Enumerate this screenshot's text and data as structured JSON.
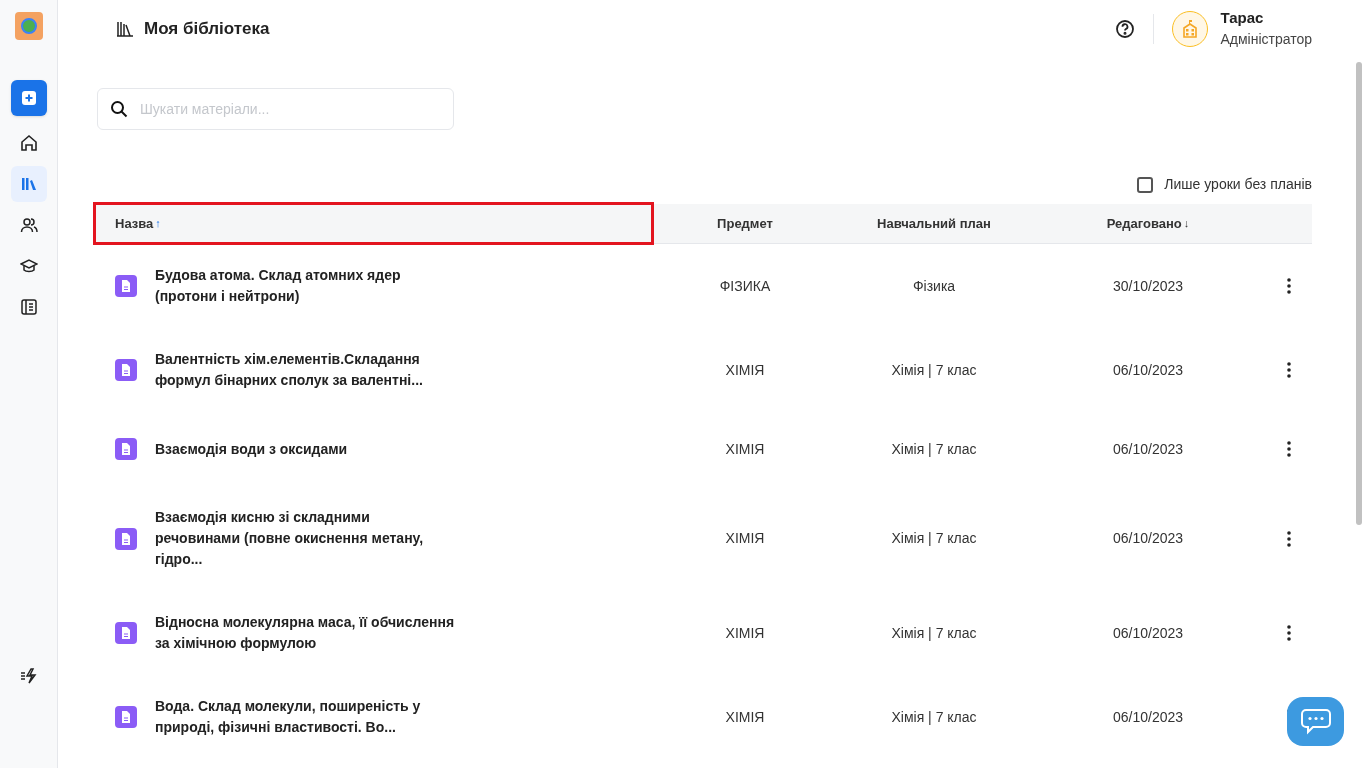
{
  "sidebar": {
    "items": [
      {
        "kind": "home",
        "selected": false
      },
      {
        "kind": "library",
        "selected": true
      },
      {
        "kind": "people",
        "selected": false
      },
      {
        "kind": "cap",
        "selected": false
      },
      {
        "kind": "book",
        "selected": false
      }
    ],
    "bottom_items": [
      {
        "kind": "flash",
        "selected": false
      }
    ]
  },
  "header": {
    "title": "Моя бібліотека",
    "user": {
      "name": "Тарас",
      "role": "Адміністратор"
    }
  },
  "search": {
    "placeholder": "Шукати матеріали..."
  },
  "filter": {
    "label": "Лише уроки без планів",
    "checked": false
  },
  "table": {
    "columns": [
      {
        "label": "Назва",
        "sort_arrow": "↑",
        "sort_active": true
      },
      {
        "label": "Предмет"
      },
      {
        "label": "Навчальний план"
      },
      {
        "label": "Редаговано",
        "sort_arrow": "↓",
        "sort_active": false
      }
    ],
    "rows": [
      {
        "title": "Будова атома. Склад атомних ядер (протони і нейтрони)",
        "subject": "ФІЗИКА",
        "plan": "Фізика",
        "edited": "30/10/2023"
      },
      {
        "title": "Валентність хім.елементів.Складання формул бінарних сполук за валентні...",
        "subject": "ХІМІЯ",
        "plan": "Хімія | 7 клас",
        "edited": "06/10/2023"
      },
      {
        "title": "Взаємодія води з оксидами",
        "subject": "ХІМІЯ",
        "plan": "Хімія | 7 клас",
        "edited": "06/10/2023"
      },
      {
        "title": "Взаємодія кисню зі складними речовинами (повне окиснення метану, гідро...",
        "subject": "ХІМІЯ",
        "plan": "Хімія | 7 клас",
        "edited": "06/10/2023"
      },
      {
        "title": "Відносна молекулярна маса, її обчислення за хімічною формулою",
        "subject": "ХІМІЯ",
        "plan": "Хімія | 7 клас",
        "edited": "06/10/2023"
      },
      {
        "title": "Вода. Склад молекули, поширеність у природі, фізичні властивості. Во...",
        "subject": "ХІМІЯ",
        "plan": "Хімія | 7 клас",
        "edited": "06/10/2023"
      }
    ]
  }
}
